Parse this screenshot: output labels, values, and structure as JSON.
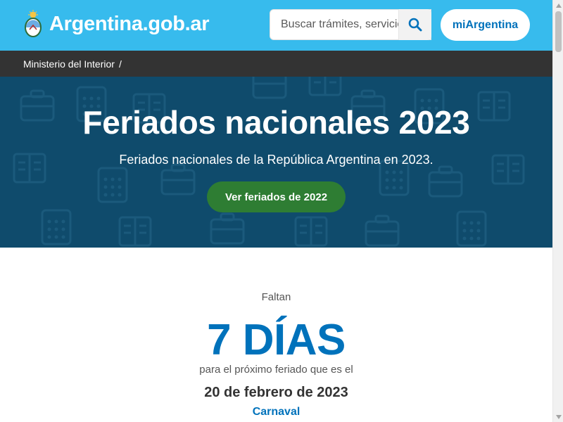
{
  "header": {
    "site_name": "Argentina.gob.ar",
    "logo_icon": "coat-of-arms-icon",
    "search_placeholder": "Buscar trámites, servicios o áreas",
    "search_icon": "search-icon",
    "account_label": "miArgentina"
  },
  "breadcrumb": {
    "items": [
      "Ministerio del Interior"
    ],
    "separator": "/"
  },
  "hero": {
    "title": "Feriados nacionales 2023",
    "subtitle": "Feriados nacionales de la República Argentina en 2023.",
    "button_label": "Ver feriados de 2022"
  },
  "countdown": {
    "prefix": "Faltan",
    "days_label": "7 DÍAS",
    "middle_text": "para el próximo feriado que es el",
    "date": "20 de febrero de 2023",
    "holiday_name": "Carnaval"
  },
  "colors": {
    "topbar": "#37bbed",
    "breadcrumb_bg": "#333333",
    "hero_bg": "#0f4b6c",
    "primary": "#0072bb",
    "success": "#2e7d33"
  }
}
